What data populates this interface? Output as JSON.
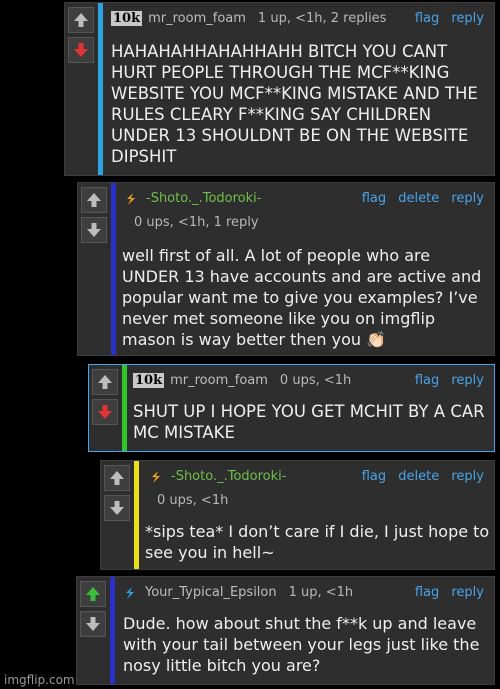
{
  "comments": [
    {
      "badge": "10k",
      "user": "mr_room_foam",
      "meta": "1 up, <1h, 2 replies",
      "links": [
        "flag",
        "reply"
      ],
      "text": "HAHAHAHHAHAHHAHH BITCH YOU CANT HURT PEOPLE THROUGH THE MCF**KING WEBSITE YOU MCF**KING MISTAKE AND THE RULES CLEARY F**KING SAY CHILDREN UNDER 13 SHOULDNT BE ON THE WEBSITE DIPSHIT",
      "bar_color": "#2aa3e0"
    },
    {
      "user": "-Shoto._.Todoroki-",
      "meta": "0 ups, <1h, 1 reply",
      "links": [
        "flag",
        "delete",
        "reply"
      ],
      "text": "well first of all. A lot of people who are UNDER 13 have accounts and are active and popular want me to give you examples? I’ve never met someone like you on imgflip mason is way better then you 👏🏻",
      "bar_color": "#2b31c8"
    },
    {
      "badge": "10k",
      "user": "mr_room_foam",
      "meta": "0 ups, <1h",
      "links": [
        "flag",
        "reply"
      ],
      "text": "SHUT UP I HOPE YOU GET MCHIT BY A CAR MC MISTAKE",
      "bar_color": "#31c42b"
    },
    {
      "user": "-Shoto._.Todoroki-",
      "meta": "0 ups, <1h",
      "links": [
        "flag",
        "delete",
        "reply"
      ],
      "text": "*sips tea* I don’t care if I die, I just hope to see you in hell~",
      "bar_color": "#e8df1a"
    },
    {
      "user": "Your_Typical_Epsilon",
      "meta": "1 up, <1h",
      "links": [
        "flag",
        "reply"
      ],
      "text": "Dude. how about shut the f**k up and leave with your tail between your legs just like the nosy little bitch you are?",
      "bar_color": "#2b31c8"
    }
  ],
  "watermark": "imgflip.com",
  "colors": {
    "link": "#4aa3e8",
    "upvote_active": "#3bbd3b",
    "downvote_active": "#e03535"
  }
}
